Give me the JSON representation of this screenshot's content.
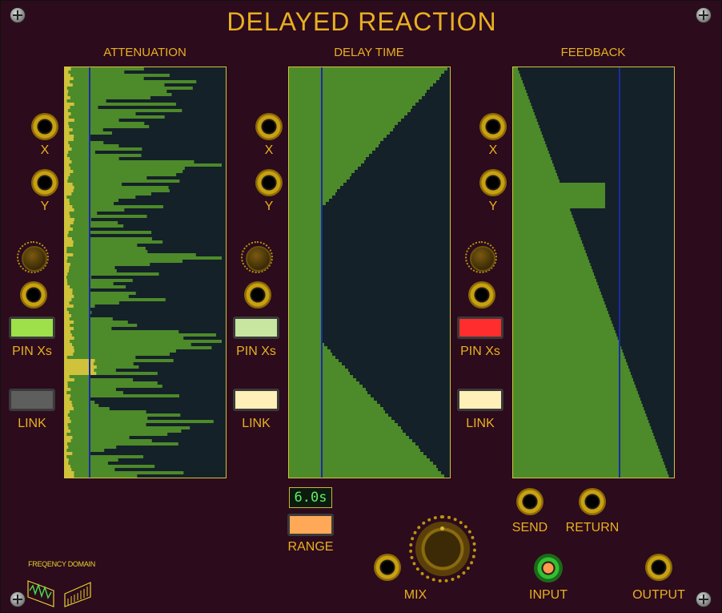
{
  "title": "DELAYED REACTION",
  "panels": [
    {
      "label": "ATTENUATION",
      "pin_label": "PIN Xs",
      "link_label": "LINK",
      "pin_color": "#9ee04a",
      "link_color": "#5e5e5e"
    },
    {
      "label": "DELAY TIME",
      "pin_label": "PIN Xs",
      "link_label": "LINK",
      "pin_color": "#c8e6a0",
      "link_color": "#ffefb8"
    },
    {
      "label": "FEEDBACK",
      "pin_label": "PIN Xs",
      "link_label": "LINK",
      "pin_color": "#ff2d2d",
      "link_color": "#ffefb8"
    }
  ],
  "jack_labels": {
    "x": "X",
    "y": "Y"
  },
  "range": {
    "display": "6.0s",
    "label": "RANGE",
    "button_color": "#ffa858"
  },
  "io": {
    "send": "SEND",
    "return": "RETURN",
    "mix": "MIX",
    "input": "INPUT",
    "output": "OUTPUT"
  },
  "logo": {
    "text": "FREQENCY DOMAIN"
  },
  "colors": {
    "accent": "#e8b020",
    "bars": "#4d8a2a",
    "background": "#2c0b1c",
    "cursor": "#1a2aa8",
    "spectrum": "#d0c23a"
  }
}
